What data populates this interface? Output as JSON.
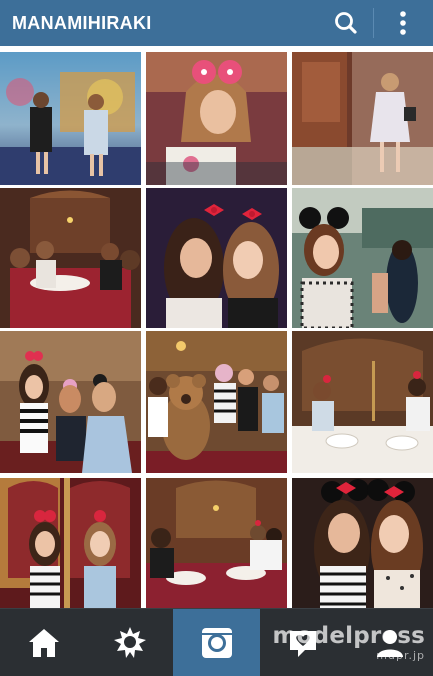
{
  "app": {
    "profile_name": "MANAMIHIRAKI",
    "accent_color": "#3d6f99",
    "nav_bg_color": "#2b2f33"
  },
  "top_bar": {
    "search_icon": "search-icon",
    "menu_icon": "more-vertical-icon"
  },
  "grid": {
    "photos": [
      {
        "subject": "two women posing in front of colorful carousel"
      },
      {
        "subject": "woman in minnie bow ears holding dessert plate"
      },
      {
        "subject": "woman in white dress in ornate hallway"
      },
      {
        "subject": "group seated at restaurant table"
      },
      {
        "subject": "two women with red bow ears, peace signs"
      },
      {
        "subject": "woman wearing mouse ears outdoors"
      },
      {
        "subject": "women with mouse ears in lobby"
      },
      {
        "subject": "group photo with teddy bear character"
      },
      {
        "subject": "group at dining table in ornate room"
      },
      {
        "subject": "two women in ornate chairs"
      },
      {
        "subject": "group seated at long dining table"
      },
      {
        "subject": "two women with bow ears, peace signs"
      }
    ]
  },
  "bottom_nav": {
    "items": [
      {
        "icon": "home-icon"
      },
      {
        "icon": "explore-icon"
      },
      {
        "icon": "camera-icon"
      },
      {
        "icon": "activity-icon"
      },
      {
        "icon": "profile-icon"
      }
    ],
    "active_index": 2
  },
  "watermark": {
    "brand": "modelpress",
    "url": "mdpr.jp"
  }
}
